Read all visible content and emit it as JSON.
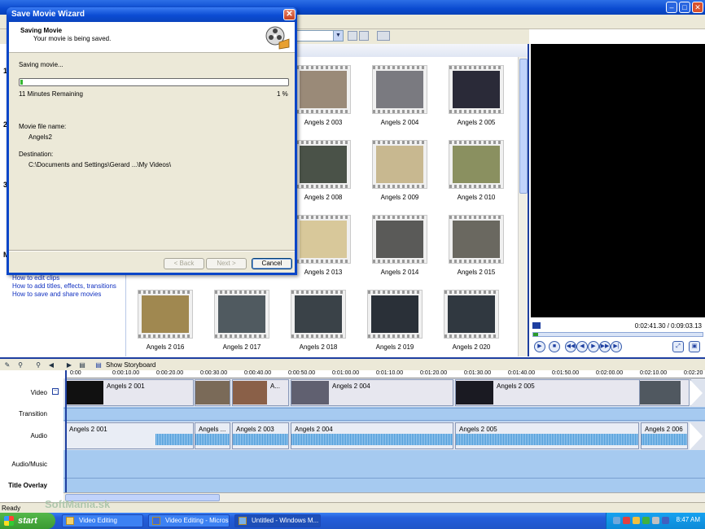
{
  "dialog": {
    "title": "Save Movie Wizard",
    "close_glyph": "✕",
    "heading": "Saving Movie",
    "subheading": "Your movie is being saved.",
    "status": "Saving movie...",
    "progress_percent": 1,
    "time_remaining": "11 Minutes Remaining",
    "percent_label": "1 %",
    "file_name_label": "Movie file name:",
    "file_name": "Angels2",
    "destination_label": "Destination:",
    "destination": "C:\\Documents and Settings\\Gerard ...\\My Videos\\",
    "back_label": "< Back",
    "next_label": "Next >",
    "cancel_label": "Cancel"
  },
  "tasks": {
    "step_numbers": [
      "1",
      "2",
      "3",
      "M"
    ],
    "links": [
      "How to edit clips",
      "How to add titles, effects, transitions",
      "How to save and share movies"
    ]
  },
  "collection": {
    "clips": [
      {
        "label": "Angels 2 003",
        "color": "#9a8a78"
      },
      {
        "label": "Angels 2 004",
        "color": "#7a7a80"
      },
      {
        "label": "Angels 2 005",
        "color": "#2a2a38"
      },
      {
        "label": "Angels 2 008",
        "color": "#4a5248"
      },
      {
        "label": "Angels 2 009",
        "color": "#c8b890"
      },
      {
        "label": "Angels 2 010",
        "color": "#8a9060"
      },
      {
        "label": "Angels 2 013",
        "color": "#d8c89a"
      },
      {
        "label": "Angels 2 014",
        "color": "#5a5a58"
      },
      {
        "label": "Angels 2 015",
        "color": "#6a6860"
      },
      {
        "label": "Angels 2 016",
        "color": "#a08850"
      },
      {
        "label": "Angels 2 017",
        "color": "#505a60"
      },
      {
        "label": "Angels 2 018",
        "color": "#3a4248"
      },
      {
        "label": "Angels 2 019",
        "color": "#2a3038"
      },
      {
        "label": "Angels 2 020",
        "color": "#303840"
      }
    ]
  },
  "monitor": {
    "timecode": "0:02:41.30 / 0:09:03.13",
    "seek_percent": 3,
    "buttons": [
      "▶",
      "■",
      "◀◀",
      "◀",
      "▶",
      "▶▶",
      "▶|"
    ],
    "right_buttons": [
      "⤢",
      "▣"
    ]
  },
  "timeline": {
    "show_storyboard_label": "Show Storyboard",
    "toolbar_icons": [
      "✎",
      "⚲",
      "⚲",
      "◀",
      "▶",
      "▤"
    ],
    "ruler_ticks": [
      "0:00",
      "0:00:10.00",
      "0:00:20.00",
      "0:00:30.00",
      "0:00:40.00",
      "0:00:50.00",
      "0:01:00.00",
      "0:01:10.00",
      "0:01:20.00",
      "0:01:30.00",
      "0:01:40.00",
      "0:01:50.00",
      "0:02:00.00",
      "0:02:10.00",
      "0:02:20"
    ],
    "track_labels": [
      "Video",
      "Transition",
      "Audio",
      "Audio/Music",
      "Title Overlay"
    ],
    "video_clips": [
      {
        "label": "Angels 2 001"
      },
      {
        "label": ""
      },
      {
        "label": "A..."
      },
      {
        "label": "Angels 2 004"
      },
      {
        "label": "Angels 2 005"
      },
      {
        "label": ""
      }
    ],
    "audio_clips": [
      {
        "label": "Angels 2 001"
      },
      {
        "label": "Angels ..."
      },
      {
        "label": "Angels 2 003"
      },
      {
        "label": "Angels 2 004"
      },
      {
        "label": "Angels 2 005"
      },
      {
        "label": "Angels 2 006"
      }
    ]
  },
  "status_bar": {
    "text": "Ready"
  },
  "taskbar": {
    "start_label": "start",
    "buttons": [
      "Video Editing",
      "Video Editing - Micros...",
      "Untitled - Windows M..."
    ],
    "clock": "8:47 AM"
  },
  "watermark": "SoftMania.sk"
}
